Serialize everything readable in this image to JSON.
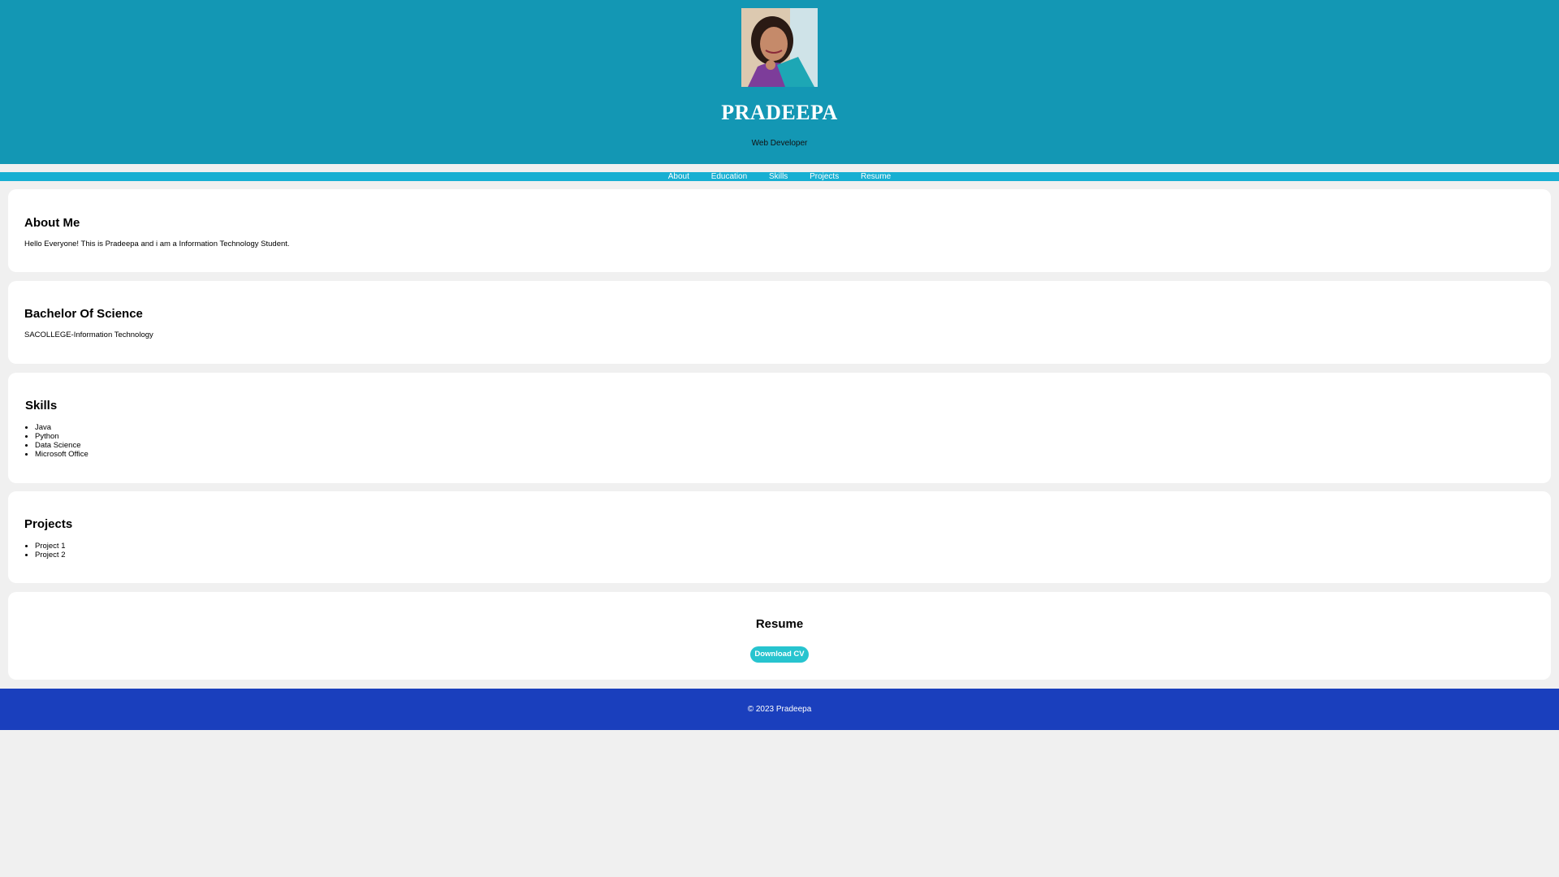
{
  "header": {
    "name": "PRADEEPA",
    "role": "Web Developer"
  },
  "nav": {
    "items": [
      "About",
      "Education",
      "Skills",
      "Projects",
      "Resume"
    ]
  },
  "about": {
    "title": "About Me",
    "text": "Hello Everyone! This is Pradeepa and i am a Information Technology Student."
  },
  "education": {
    "title": "Bachelor Of Science",
    "text": "SACOLLEGE-Information Technology"
  },
  "skills": {
    "title": "Skills",
    "items": [
      "Java",
      "Python",
      "Data Science",
      "Microsoft Office"
    ]
  },
  "projects": {
    "title": "Projects",
    "items": [
      "Project 1",
      "Project 2"
    ]
  },
  "resume": {
    "title": "Resume",
    "button_label": "Download CV"
  },
  "footer": {
    "text": "© 2023 Pradeepa"
  },
  "colors": {
    "header_bg": "#1397b4",
    "nav_bg": "#17afd2",
    "footer_bg": "#1a3fbd",
    "button_bg": "#27c4cf",
    "page_bg": "#f0f0f0"
  }
}
